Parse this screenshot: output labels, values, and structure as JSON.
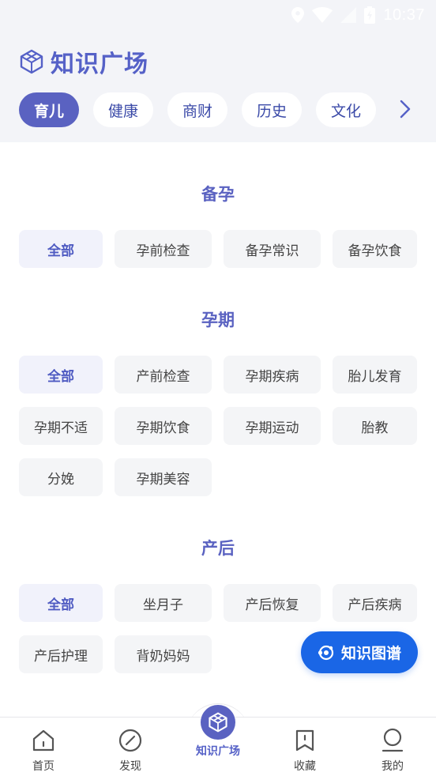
{
  "status_bar": {
    "time": "10:37"
  },
  "header": {
    "title": "知识广场"
  },
  "tabs": [
    "育儿",
    "健康",
    "商财",
    "历史",
    "文化"
  ],
  "sections": [
    {
      "title": "备孕",
      "items": [
        "全部",
        "孕前检查",
        "备孕常识",
        "备孕饮食"
      ]
    },
    {
      "title": "孕期",
      "items": [
        "全部",
        "产前检查",
        "孕期疾病",
        "胎儿发育",
        "孕期不适",
        "孕期饮食",
        "孕期运动",
        "胎教",
        "分娩",
        "孕期美容"
      ]
    },
    {
      "title": "产后",
      "items": [
        "全部",
        "坐月子",
        "产后恢复",
        "产后疾病",
        "产后护理",
        "背奶妈妈"
      ]
    }
  ],
  "fab": {
    "label": "知识图谱"
  },
  "nav": [
    "首页",
    "发现",
    "知识广场",
    "收藏",
    "我的"
  ],
  "colors": {
    "accent": "#5a62c1",
    "fab": "#1a66e6"
  }
}
